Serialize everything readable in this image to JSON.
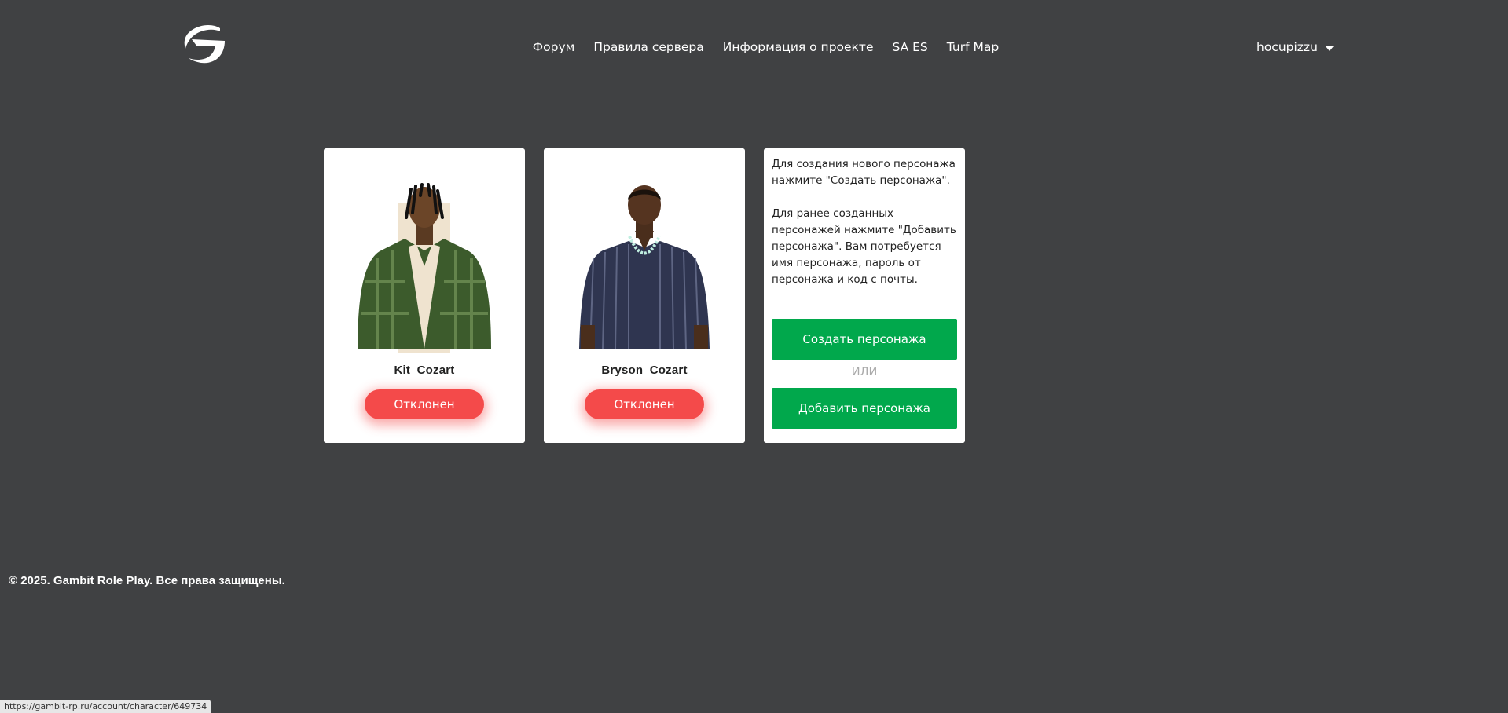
{
  "header": {
    "logo_icon": "gambit-g-logo",
    "nav": [
      {
        "label": "Форум"
      },
      {
        "label": "Правила сервера"
      },
      {
        "label": "Информация о проекте"
      },
      {
        "label": "SA ES"
      },
      {
        "label": "Turf Map"
      }
    ],
    "user": {
      "name": "hocupizzu",
      "icon": "chevron-down-icon"
    }
  },
  "characters": [
    {
      "name": "Kit_Cozart",
      "status": "Отклонен",
      "status_color": "#f44a4a"
    },
    {
      "name": "Bryson_Cozart",
      "status": "Отклонен",
      "status_color": "#f44a4a"
    }
  ],
  "info_card": {
    "paragraph1": "Для создания нового персонажа нажмите \"Создать персонажа\".",
    "paragraph2": "Для ранее созданных персонажей нажмите \"Добавить персонажа\". Вам потребуется имя персонажа, пароль от персонажа и код с почты.",
    "create_label": "Создать персонажа",
    "or_label": "ИЛИ",
    "add_label": "Добавить персонажа",
    "button_color": "#01a84c"
  },
  "footer": {
    "copyright": "© 2025. Gambit Role Play. Все права защищены."
  },
  "status_bar": {
    "url": "https://gambit-rp.ru/account/character/649734"
  }
}
